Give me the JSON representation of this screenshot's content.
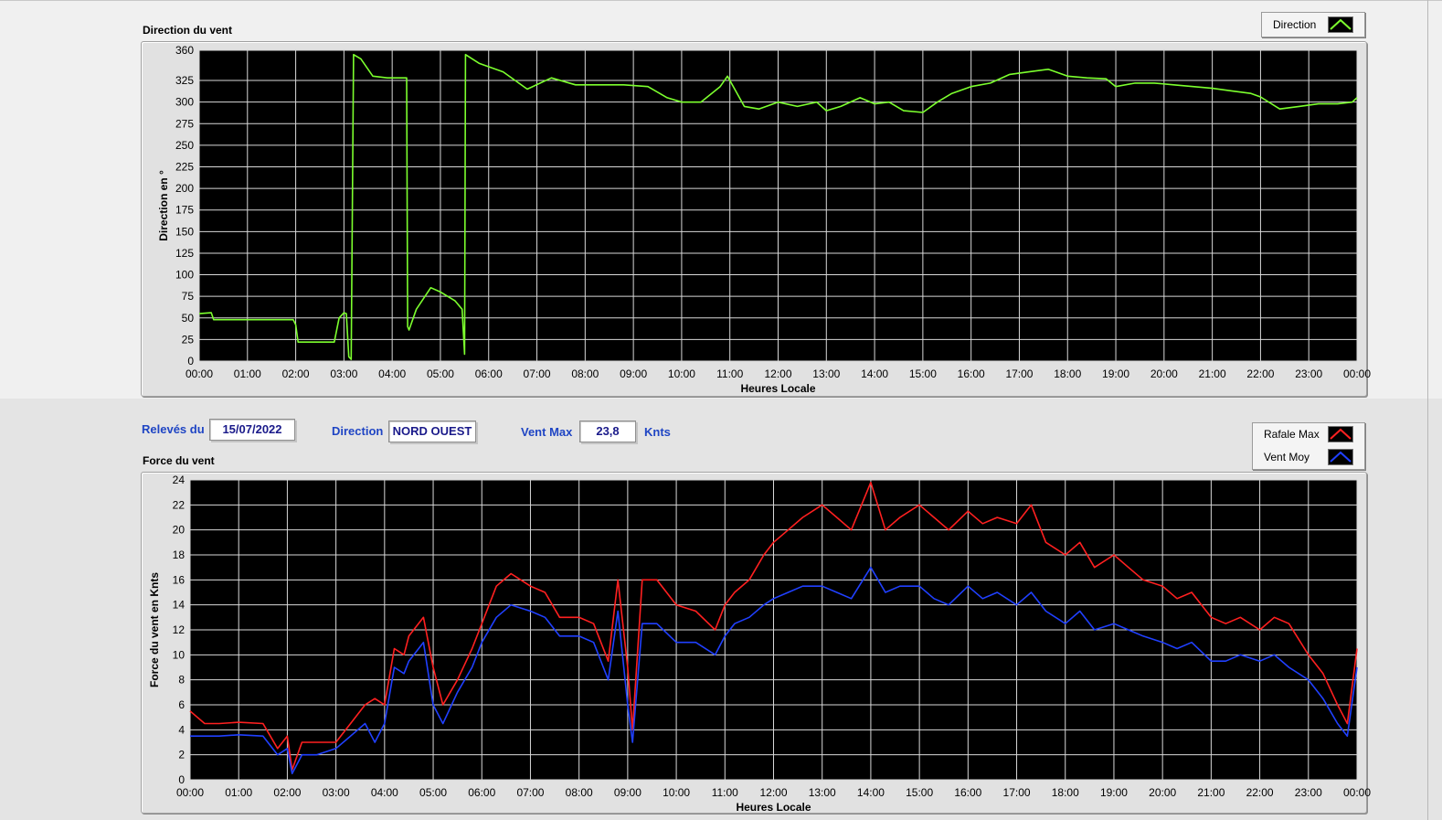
{
  "colors": {
    "plot_bg": "#000000",
    "grid": "#d8d8d8",
    "direction_line": "#7cff2e",
    "gust_line": "#ff2020",
    "mean_line": "#2040ff",
    "info_text": "#1f45c4"
  },
  "direction_panel": {
    "title": "Direction du vent",
    "legend": [
      {
        "label": "Direction",
        "color": "#7cff2e",
        "icon": "line-plot-icon"
      }
    ]
  },
  "info": {
    "date_label": "Relevés du",
    "date_value": "15/07/2022",
    "direction_label": "Direction",
    "direction_value": "NORD OUEST",
    "vmax_label": "Vent Max",
    "vmax_value": "23,8",
    "vmax_unit": "Knts"
  },
  "force_panel": {
    "title": "Force du vent",
    "legend": [
      {
        "label": "Rafale Max",
        "color": "#ff2020",
        "icon": "line-plot-icon"
      },
      {
        "label": "Vent Moy",
        "color": "#2040ff",
        "icon": "line-plot-icon"
      }
    ]
  },
  "chart_data": [
    {
      "type": "line",
      "title": "",
      "xlabel": "Heures Locale",
      "ylabel": "Direction en °",
      "x_ticks": [
        "00:00",
        "01:00",
        "02:00",
        "03:00",
        "04:00",
        "05:00",
        "06:00",
        "07:00",
        "08:00",
        "09:00",
        "10:00",
        "11:00",
        "12:00",
        "13:00",
        "14:00",
        "15:00",
        "16:00",
        "17:00",
        "18:00",
        "19:00",
        "20:00",
        "21:00",
        "22:00",
        "23:00",
        "00:00"
      ],
      "xlim": [
        0,
        24
      ],
      "ylim": [
        0,
        360
      ],
      "y_ticks": [
        0,
        25,
        50,
        75,
        100,
        125,
        150,
        175,
        200,
        225,
        250,
        275,
        300,
        325,
        360
      ],
      "grid": true,
      "legend_position": "top-right",
      "series": [
        {
          "name": "Direction",
          "color": "#7cff2e",
          "x": [
            0,
            0.25,
            0.3,
            0.6,
            1.0,
            1.5,
            1.95,
            2.0,
            2.05,
            2.5,
            2.8,
            2.9,
            3.0,
            3.05,
            3.1,
            3.15,
            3.2,
            3.35,
            3.6,
            3.9,
            4.3,
            4.32,
            4.35,
            4.5,
            4.8,
            5.0,
            5.3,
            5.45,
            5.5,
            5.52,
            5.8,
            6.3,
            6.8,
            7.3,
            7.8,
            8.3,
            8.8,
            9.3,
            9.7,
            10.0,
            10.4,
            10.8,
            10.95,
            11.1,
            11.3,
            11.6,
            12.0,
            12.4,
            12.8,
            13.0,
            13.3,
            13.7,
            14.0,
            14.3,
            14.6,
            15.0,
            15.3,
            15.6,
            16.0,
            16.4,
            16.8,
            17.2,
            17.6,
            18.0,
            18.4,
            18.8,
            19.0,
            19.4,
            19.8,
            20.2,
            20.6,
            21.0,
            21.4,
            21.8,
            22.0,
            22.4,
            22.8,
            23.2,
            23.6,
            23.9,
            24
          ],
          "values": [
            55,
            56,
            48,
            48,
            48,
            48,
            48,
            42,
            22,
            22,
            22,
            50,
            56,
            55,
            5,
            2,
            355,
            350,
            330,
            328,
            328,
            40,
            36,
            60,
            85,
            80,
            70,
            60,
            8,
            355,
            345,
            335,
            315,
            328,
            320,
            320,
            320,
            318,
            305,
            300,
            300,
            318,
            330,
            315,
            295,
            292,
            300,
            295,
            300,
            290,
            295,
            305,
            298,
            300,
            290,
            288,
            300,
            310,
            318,
            322,
            332,
            335,
            338,
            330,
            328,
            327,
            318,
            322,
            322,
            320,
            318,
            316,
            313,
            310,
            306,
            292,
            295,
            298,
            298,
            300,
            305
          ]
        }
      ]
    },
    {
      "type": "line",
      "title": "",
      "xlabel": "Heures Locale",
      "ylabel": "Force du vent en Knts",
      "x_ticks": [
        "00:00",
        "01:00",
        "02:00",
        "03:00",
        "04:00",
        "05:00",
        "06:00",
        "07:00",
        "08:00",
        "09:00",
        "10:00",
        "11:00",
        "12:00",
        "13:00",
        "14:00",
        "15:00",
        "16:00",
        "17:00",
        "18:00",
        "19:00",
        "20:00",
        "21:00",
        "22:00",
        "23:00",
        "00:00"
      ],
      "xlim": [
        0,
        24
      ],
      "ylim": [
        0,
        24
      ],
      "y_ticks": [
        0,
        2,
        4,
        6,
        8,
        10,
        12,
        14,
        16,
        18,
        20,
        22,
        24
      ],
      "grid": true,
      "legend_position": "top-right",
      "series": [
        {
          "name": "Rafale Max",
          "color": "#ff2020",
          "x": [
            0,
            0.3,
            0.6,
            1.0,
            1.5,
            1.8,
            2.0,
            2.1,
            2.3,
            2.6,
            3.0,
            3.3,
            3.6,
            3.8,
            4.0,
            4.2,
            4.4,
            4.5,
            4.8,
            5.0,
            5.2,
            5.5,
            5.8,
            6.0,
            6.3,
            6.6,
            7.0,
            7.3,
            7.6,
            8.0,
            8.3,
            8.6,
            8.8,
            9.0,
            9.1,
            9.3,
            9.6,
            10.0,
            10.4,
            10.8,
            11.0,
            11.2,
            11.5,
            11.8,
            12.0,
            12.3,
            12.6,
            13.0,
            13.3,
            13.6,
            14.0,
            14.3,
            14.6,
            15.0,
            15.3,
            15.6,
            16.0,
            16.3,
            16.6,
            17.0,
            17.3,
            17.6,
            18.0,
            18.3,
            18.6,
            19.0,
            19.3,
            19.6,
            20.0,
            20.3,
            20.6,
            21.0,
            21.3,
            21.6,
            22.0,
            22.3,
            22.6,
            23.0,
            23.3,
            23.6,
            23.8,
            24.0
          ],
          "values": [
            5.5,
            4.5,
            4.5,
            4.6,
            4.5,
            2.5,
            3.5,
            0.8,
            3.0,
            3.0,
            3.0,
            4.5,
            6.0,
            6.5,
            6.0,
            10.5,
            10.0,
            11.5,
            13.0,
            9.0,
            6.0,
            8.0,
            10.5,
            12.5,
            15.5,
            16.5,
            15.5,
            15.0,
            13.0,
            13.0,
            12.5,
            9.5,
            16.0,
            9.0,
            4.0,
            16.0,
            16.0,
            14.0,
            13.5,
            12.0,
            14.0,
            15.0,
            16.0,
            18.0,
            19.0,
            20.0,
            21.0,
            22.0,
            21.0,
            20.0,
            23.8,
            20.0,
            21.0,
            22.0,
            21.0,
            20.0,
            21.5,
            20.5,
            21.0,
            20.5,
            22.0,
            19.0,
            18.0,
            19.0,
            17.0,
            18.0,
            17.0,
            16.0,
            15.5,
            14.5,
            15.0,
            13.0,
            12.5,
            13.0,
            12.0,
            13.0,
            12.5,
            10.0,
            8.5,
            6.0,
            4.5,
            10.5
          ]
        },
        {
          "name": "Vent Moy",
          "color": "#2040ff",
          "x": [
            0,
            0.3,
            0.6,
            1.0,
            1.5,
            1.8,
            2.0,
            2.1,
            2.3,
            2.6,
            3.0,
            3.3,
            3.6,
            3.8,
            4.0,
            4.2,
            4.4,
            4.5,
            4.8,
            5.0,
            5.2,
            5.5,
            5.8,
            6.0,
            6.3,
            6.6,
            7.0,
            7.3,
            7.6,
            8.0,
            8.3,
            8.6,
            8.8,
            9.0,
            9.1,
            9.3,
            9.6,
            10.0,
            10.4,
            10.8,
            11.0,
            11.2,
            11.5,
            11.8,
            12.0,
            12.3,
            12.6,
            13.0,
            13.3,
            13.6,
            14.0,
            14.3,
            14.6,
            15.0,
            15.3,
            15.6,
            16.0,
            16.3,
            16.6,
            17.0,
            17.3,
            17.6,
            18.0,
            18.3,
            18.6,
            19.0,
            19.3,
            19.6,
            20.0,
            20.3,
            20.6,
            21.0,
            21.3,
            21.6,
            22.0,
            22.3,
            22.6,
            23.0,
            23.3,
            23.6,
            23.8,
            24.0
          ],
          "values": [
            3.5,
            3.5,
            3.5,
            3.6,
            3.5,
            2.0,
            2.5,
            0.5,
            2.0,
            2.0,
            2.5,
            3.5,
            4.5,
            3.0,
            4.5,
            9.0,
            8.5,
            9.5,
            11.0,
            6.0,
            4.5,
            7.0,
            9.0,
            11.0,
            13.0,
            14.0,
            13.5,
            13.0,
            11.5,
            11.5,
            11.0,
            8.0,
            13.5,
            6.0,
            3.0,
            12.5,
            12.5,
            11.0,
            11.0,
            10.0,
            11.5,
            12.5,
            13.0,
            14.0,
            14.5,
            15.0,
            15.5,
            15.5,
            15.0,
            14.5,
            17.0,
            15.0,
            15.5,
            15.5,
            14.5,
            14.0,
            15.5,
            14.5,
            15.0,
            14.0,
            15.0,
            13.5,
            12.5,
            13.5,
            12.0,
            12.5,
            12.0,
            11.5,
            11.0,
            10.5,
            11.0,
            9.5,
            9.5,
            10.0,
            9.5,
            10.0,
            9.0,
            8.0,
            6.5,
            4.5,
            3.5,
            9.0
          ]
        }
      ]
    }
  ]
}
